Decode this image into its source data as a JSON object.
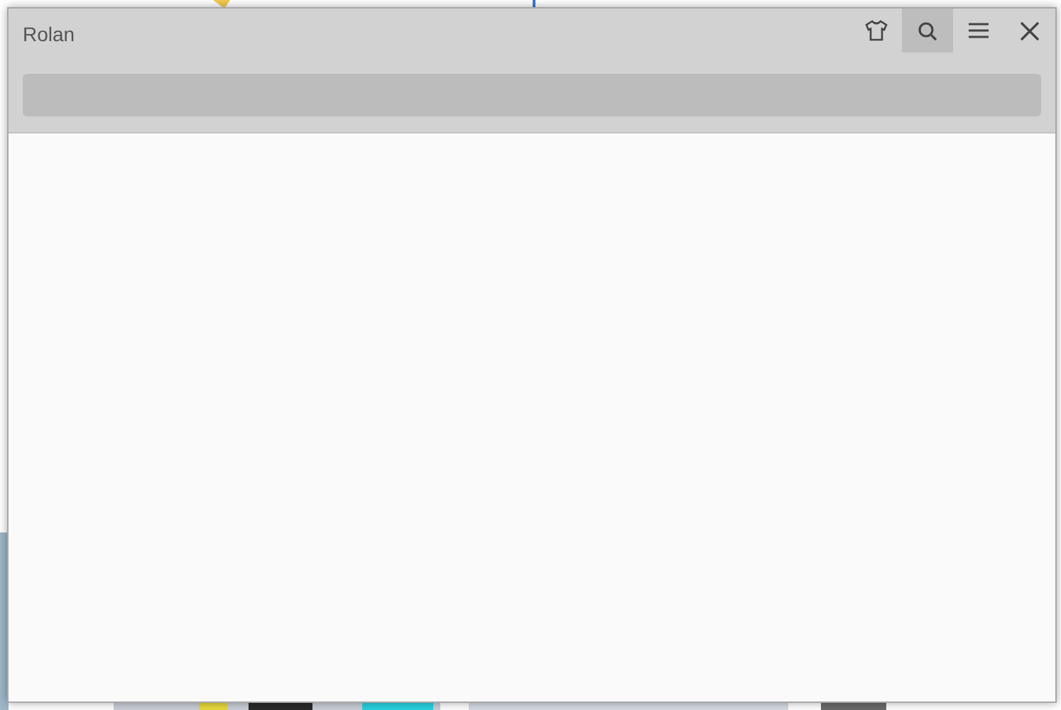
{
  "window": {
    "title": "Rolan"
  },
  "title_buttons": [
    {
      "kind": "skin",
      "active": false
    },
    {
      "kind": "search",
      "active": true
    },
    {
      "kind": "menu",
      "active": false
    },
    {
      "kind": "close",
      "active": false
    }
  ]
}
